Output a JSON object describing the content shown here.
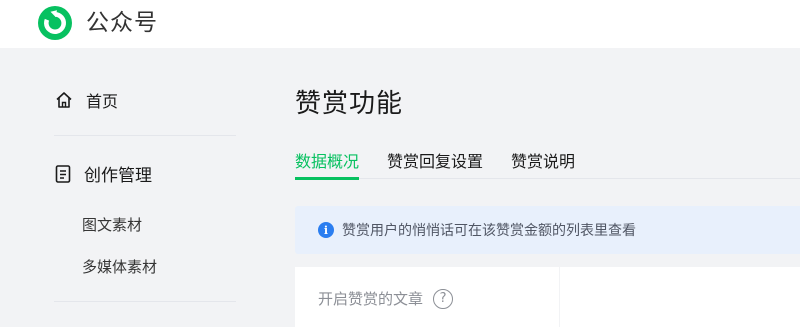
{
  "header": {
    "brand": "公众号",
    "logo_icon": "wechat-official-account-logo",
    "logo_color": "#07c160"
  },
  "sidebar": {
    "home": {
      "label": "首页",
      "icon": "home-icon"
    },
    "creation": {
      "label": "创作管理",
      "icon": "document-icon",
      "items": [
        {
          "label": "图文素材"
        },
        {
          "label": "多媒体素材"
        }
      ]
    }
  },
  "main": {
    "title": "赞赏功能",
    "tabs": [
      {
        "label": "数据概况",
        "active": true
      },
      {
        "label": "赞赏回复设置",
        "active": false
      },
      {
        "label": "赞赏说明",
        "active": false
      }
    ],
    "notice": {
      "icon": "info-icon",
      "text": "赞赏用户的悄悄话可在该赞赏金额的列表里查看"
    },
    "stat_card": {
      "label": "开启赞赏的文章",
      "help_icon": "question-circle-icon"
    }
  },
  "colors": {
    "accent": "#07c160",
    "info": "#2b7ef0",
    "notice_bg": "#e8f0fc",
    "page_bg": "#f2f3f5"
  }
}
